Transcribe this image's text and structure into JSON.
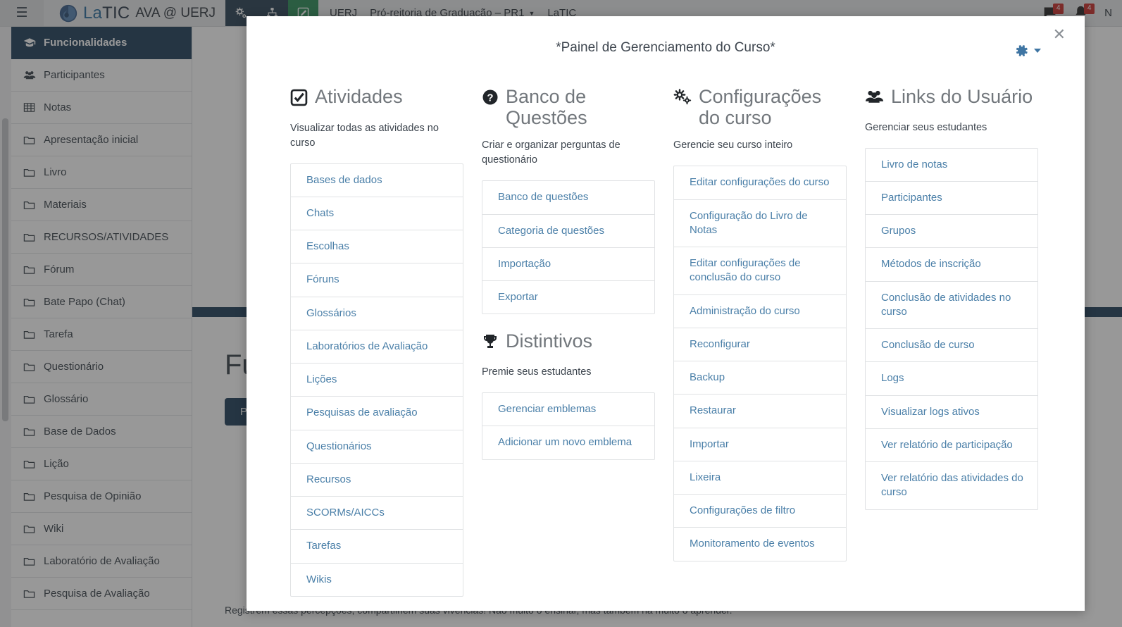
{
  "navbar": {
    "burger_icon": "hamburger-menu-icon",
    "brand_main_a": "La",
    "brand_main_b": "TIC",
    "brand_sub": "AVA @ UERJ",
    "icon_buttons": [
      {
        "name": "cogs-icon",
        "glyph": "⚙"
      },
      {
        "name": "sitemap-icon",
        "glyph": "⑂"
      },
      {
        "name": "edit-pencil-icon",
        "glyph": "✎"
      }
    ],
    "crumbs": [
      {
        "label": "UERJ",
        "caret": false
      },
      {
        "label": "Pró-reitoria de Graduação – PR1",
        "caret": true
      },
      {
        "label": "LaTIC",
        "caret": false
      }
    ],
    "notifications": [
      {
        "name": "messages-icon",
        "count": "4"
      },
      {
        "name": "bell-icon",
        "count": "4"
      }
    ],
    "user_label": "N"
  },
  "sidebar": {
    "items": [
      {
        "label": "Funcionalidades",
        "icon": "graduation-cap-icon",
        "active": true
      },
      {
        "label": "Participantes",
        "icon": "users-icon",
        "active": false
      },
      {
        "label": "Notas",
        "icon": "table-icon",
        "active": false
      },
      {
        "label": "Apresentação inicial",
        "icon": "folder-icon",
        "active": false
      },
      {
        "label": "Livro",
        "icon": "folder-icon",
        "active": false
      },
      {
        "label": "Materiais",
        "icon": "folder-icon",
        "active": false
      },
      {
        "label": "RECURSOS/ATIVIDADES",
        "icon": "folder-icon",
        "active": false
      },
      {
        "label": "Fórum",
        "icon": "folder-icon",
        "active": false
      },
      {
        "label": "Bate Papo (Chat)",
        "icon": "folder-icon",
        "active": false
      },
      {
        "label": "Tarefa",
        "icon": "folder-icon",
        "active": false
      },
      {
        "label": "Questionário",
        "icon": "folder-icon",
        "active": false
      },
      {
        "label": "Glossário",
        "icon": "folder-icon",
        "active": false
      },
      {
        "label": "Base de Dados",
        "icon": "folder-icon",
        "active": false
      },
      {
        "label": "Lição",
        "icon": "folder-icon",
        "active": false
      },
      {
        "label": "Pesquisa de Opinião",
        "icon": "folder-icon",
        "active": false
      },
      {
        "label": "Wiki",
        "icon": "folder-icon",
        "active": false
      },
      {
        "label": "Laboratório de Avaliação",
        "icon": "folder-icon",
        "active": false
      },
      {
        "label": "Pesquisa de Avaliação",
        "icon": "folder-icon",
        "active": false
      }
    ]
  },
  "main": {
    "title": "Funcionalidades",
    "button_label": "Página inicial",
    "footer_text": "Registrem essas percepções, compartilhem suas vivências! Não muito o ensinar, mas também na muito o aprender."
  },
  "modal": {
    "title": "*Painel de Gerenciamento do Curso*",
    "close_icon": "close-icon",
    "gear_icon": "gear-icon",
    "gear_caret_icon": "chevron-down-icon",
    "columns": [
      {
        "heading": "Atividades",
        "icon": "checkbox-checked-icon",
        "description": "Visualizar todas as atividades no curso",
        "items": [
          "Bases de dados",
          "Chats",
          "Escolhas",
          "Fóruns",
          "Glossários",
          "Laboratórios de Avaliação",
          "Lições",
          "Pesquisas de avaliação",
          "Questionários",
          "Recursos",
          "SCORMs/AICCs",
          "Tarefas",
          "Wikis"
        ]
      },
      {
        "heading": "Banco de Questões",
        "icon": "question-circle-icon",
        "description": "Criar e organizar perguntas de questionário",
        "items": [
          "Banco de questões",
          "Categoria de questões",
          "Importação",
          "Exportar"
        ]
      },
      {
        "heading": "Configurações do curso",
        "icon": "cogs-icon",
        "description": "Gerencie seu curso inteiro",
        "items": [
          "Editar configurações do curso",
          "Configuração do Livro de Notas",
          "Editar configurações de conclusão do curso",
          "Administração do curso",
          "Reconfigurar",
          "Backup",
          "Restaurar",
          "Importar",
          "Lixeira",
          "Configurações de filtro",
          "Monitoramento de eventos"
        ]
      },
      {
        "heading": "Links do Usuário",
        "icon": "users-icon",
        "description": "Gerenciar seus estudantes",
        "items": [
          "Livro de notas",
          "Participantes",
          "Grupos",
          "Métodos de inscrição",
          "Conclusão de atividades no curso",
          "Conclusão de curso",
          "Logs",
          "Visualizar logs ativos",
          "Ver relatório de participação",
          "Ver relatório das atividades do curso"
        ]
      }
    ],
    "badges_section": {
      "heading": "Distintivos",
      "icon": "trophy-icon",
      "description": "Premie seus estudantes",
      "items": [
        "Gerenciar emblemas",
        "Adicionar um novo emblema"
      ]
    }
  },
  "colors": {
    "navy": "#24425c",
    "link": "#4a7fa8",
    "accent_green": "#2f8f5b",
    "badge_red": "#c9302c"
  }
}
